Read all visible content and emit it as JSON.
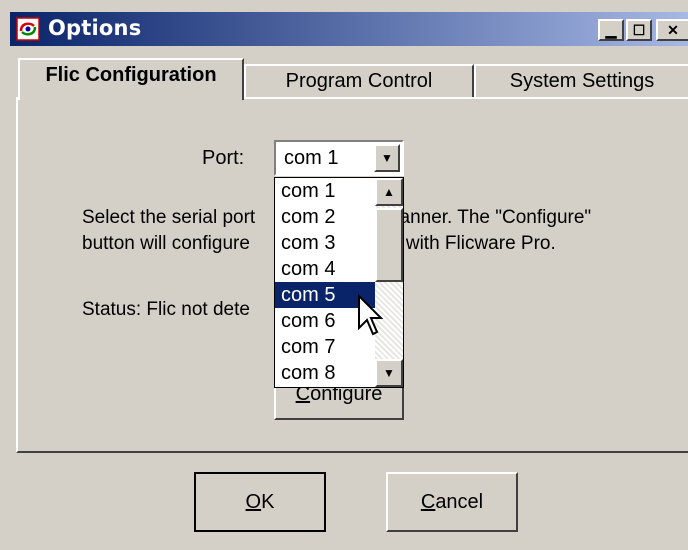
{
  "window": {
    "title": "Options"
  },
  "tabs": [
    {
      "label": "Flic Configuration",
      "active": true
    },
    {
      "label": "Program Control",
      "active": false
    },
    {
      "label": "System Settings",
      "active": false
    }
  ],
  "port": {
    "label": "Port:",
    "value": "com 1"
  },
  "dropdown": {
    "items": [
      "com 1",
      "com 2",
      "com 3",
      "com 4",
      "com 5",
      "com 6",
      "com 7",
      "com 8"
    ],
    "highlighted": "com 5"
  },
  "description": {
    "line1_left": "Select the serial port",
    "line1_right": "canner. The \"Configure\"",
    "line2_left": "button will configure",
    "line2_right": "e with Flicware Pro."
  },
  "status": {
    "text": "Status: Flic not dete"
  },
  "configure_button": {
    "label": "Configure",
    "mnemonic": "C",
    "rest": "onfigure"
  },
  "buttons": {
    "ok": {
      "mnemonic": "O",
      "rest": "K"
    },
    "cancel": {
      "mnemonic": "C",
      "rest": "ancel"
    }
  },
  "colors": {
    "titlebar_start": "#0a246a",
    "titlebar_end": "#a6b8e5",
    "selection": "#0a246a",
    "face": "#d4d0c8"
  }
}
